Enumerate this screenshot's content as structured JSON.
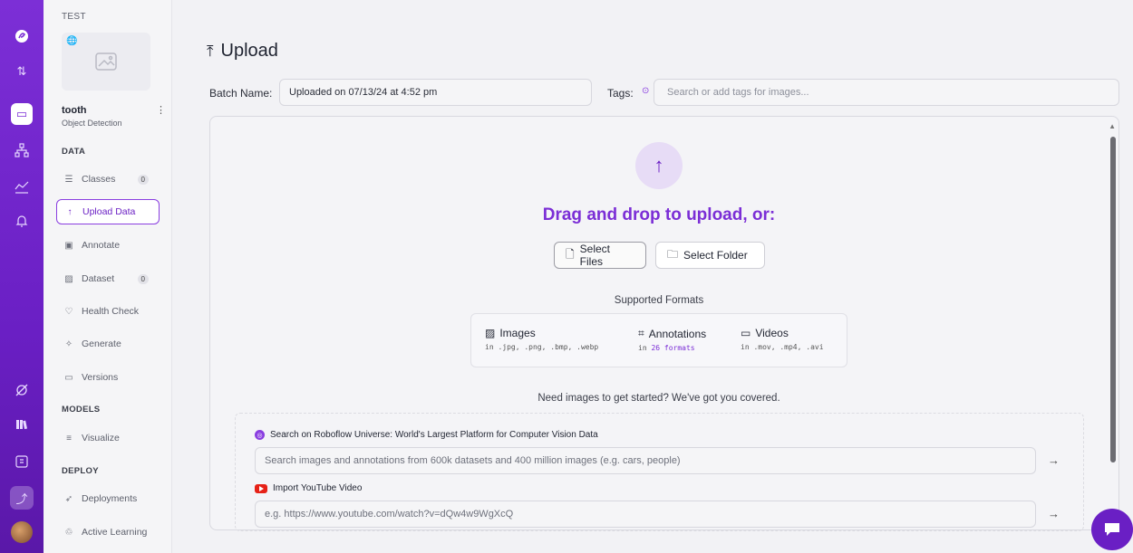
{
  "rail": {
    "icons": [
      "roboflow-logo-icon",
      "sort-arrows-icon",
      "projects-icon",
      "workflows-icon",
      "analytics-icon",
      "notifications-icon",
      "universe-icon",
      "library-icon",
      "docs-icon",
      "upload-icon"
    ]
  },
  "sidebar": {
    "workspace": "TEST",
    "project_name": "tooth",
    "project_type": "Object Detection",
    "sections": {
      "data": "DATA",
      "models": "MODELS",
      "deploy": "DEPLOY"
    },
    "items": [
      {
        "label": "Classes",
        "count": "0"
      },
      {
        "label": "Upload Data"
      },
      {
        "label": "Annotate"
      },
      {
        "label": "Dataset",
        "count": "0"
      },
      {
        "label": "Health Check"
      },
      {
        "label": "Generate"
      },
      {
        "label": "Versions"
      },
      {
        "label": "Visualize"
      },
      {
        "label": "Deployments"
      },
      {
        "label": "Active Learning"
      }
    ]
  },
  "main": {
    "title": "Upload",
    "batch_label": "Batch Name:",
    "batch_value": "Uploaded on 07/13/24 at 4:52 pm",
    "tags_label": "Tags:",
    "tags_placeholder": "Search or add tags for images...",
    "dropzone": {
      "heading": "Drag and drop to upload, or:",
      "select_files": "Select Files",
      "select_folder": "Select Folder",
      "supported_formats": "Supported Formats",
      "formats": [
        {
          "name": "Images",
          "detail": "in .jpg, .png, .bmp, .webp"
        },
        {
          "name": "Annotations",
          "detail_prefix": "in ",
          "detail_link": "26 formats"
        },
        {
          "name": "Videos",
          "detail": "in .mov, .mp4, .avi"
        }
      ],
      "need_images": "Need images to get started? We've got you covered.",
      "universe_title": "Search on Roboflow Universe: World's Largest Platform for Computer Vision Data",
      "universe_placeholder": "Search images and annotations from 600k datasets and 400 million images (e.g. cars, people)",
      "youtube_title": "Import YouTube Video",
      "youtube_placeholder": "e.g. https://www.youtube.com/watch?v=dQw4w9WgXcQ"
    }
  },
  "colors": {
    "accent": "#7b2ed6",
    "rail": "#6a1fc4"
  }
}
